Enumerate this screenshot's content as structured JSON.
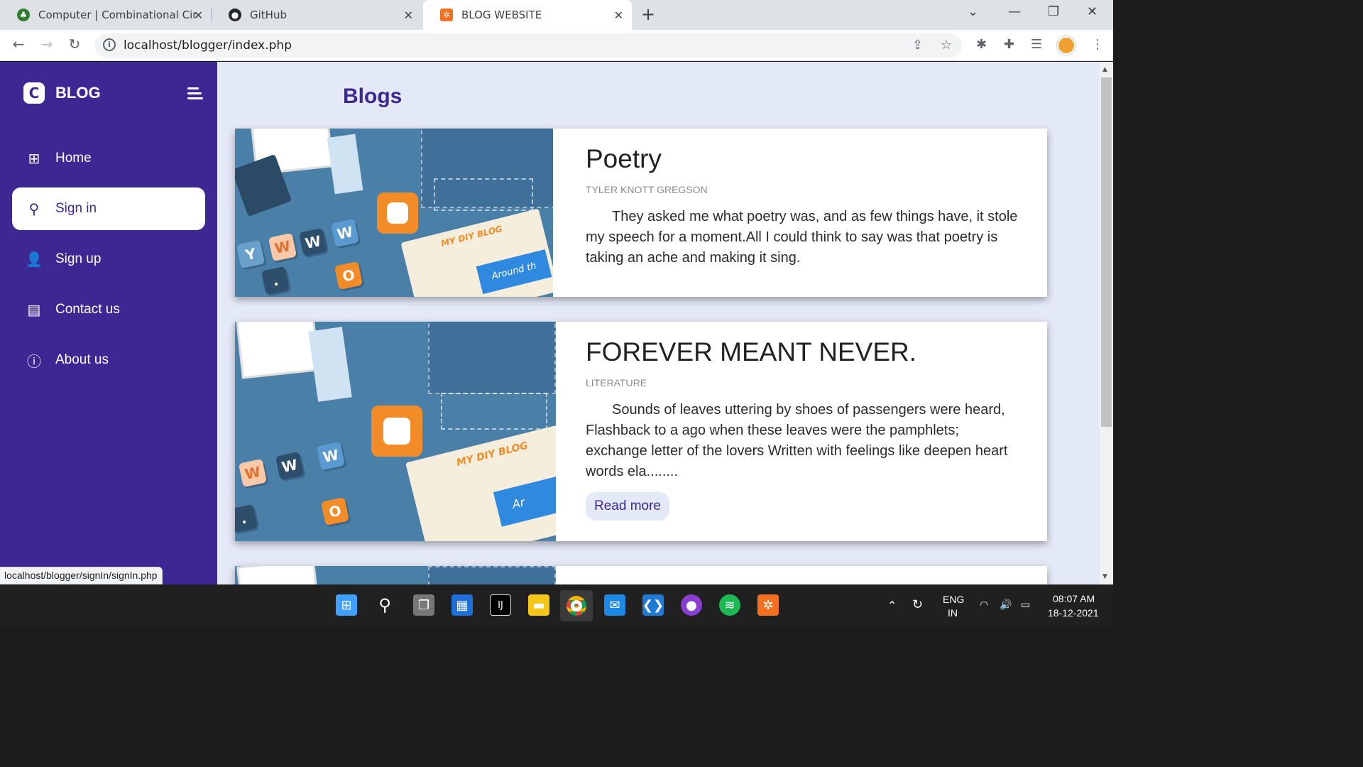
{
  "browser": {
    "tabs": [
      {
        "title": "Computer | Combinational Circuit",
        "favicon": "tree-favicon"
      },
      {
        "title": "GitHub",
        "favicon": "github-favicon"
      },
      {
        "title": "BLOG WEBSITE",
        "favicon": "xampp-favicon"
      }
    ],
    "active_tab": 2,
    "url": "localhost/blogger/index.php",
    "status_url": "localhost/blogger/signIn/signIn.php"
  },
  "sidebar": {
    "brand": "BLOG",
    "items": [
      {
        "label": "Home",
        "icon": "grid-icon"
      },
      {
        "label": "Sign in",
        "icon": "user-icon"
      },
      {
        "label": "Sign up",
        "icon": "user-plus-icon"
      },
      {
        "label": "Contact us",
        "icon": "id-card-icon"
      },
      {
        "label": "About us",
        "icon": "info-icon"
      }
    ],
    "active_item": "Sign in"
  },
  "main": {
    "page_title": "Blogs",
    "posts": [
      {
        "title": "Poetry",
        "author": "TYLER KNOTT GREGSON",
        "text": "They asked me what poetry was, and as few things have, it stole my speech for a moment.All I could think to say was that poetry is taking an ache and making it sing.",
        "thumb_text": "MY DIY BLOG",
        "thumb_caption": "Around th"
      },
      {
        "title": "FOREVER MEANT NEVER.",
        "author": "LITERATURE",
        "text": "Sounds of leaves uttering by shoes of passengers were heard, Flashback to a ago when these leaves were the pamphlets; exchange letter of the lovers Written with feelings like deepen heart words ela........",
        "read_more": "Read more",
        "thumb_text": "MY DIY BLOG",
        "thumb_caption": "Ar"
      }
    ]
  },
  "taskbar": {
    "lang_top": "ENG",
    "lang_bottom": "IN",
    "time": "08:07 AM",
    "date": "18-12-2021"
  },
  "colors": {
    "sidebar": "#3d2793",
    "page_bg": "#e4e9f7",
    "accent_orange": "#f28c28"
  }
}
